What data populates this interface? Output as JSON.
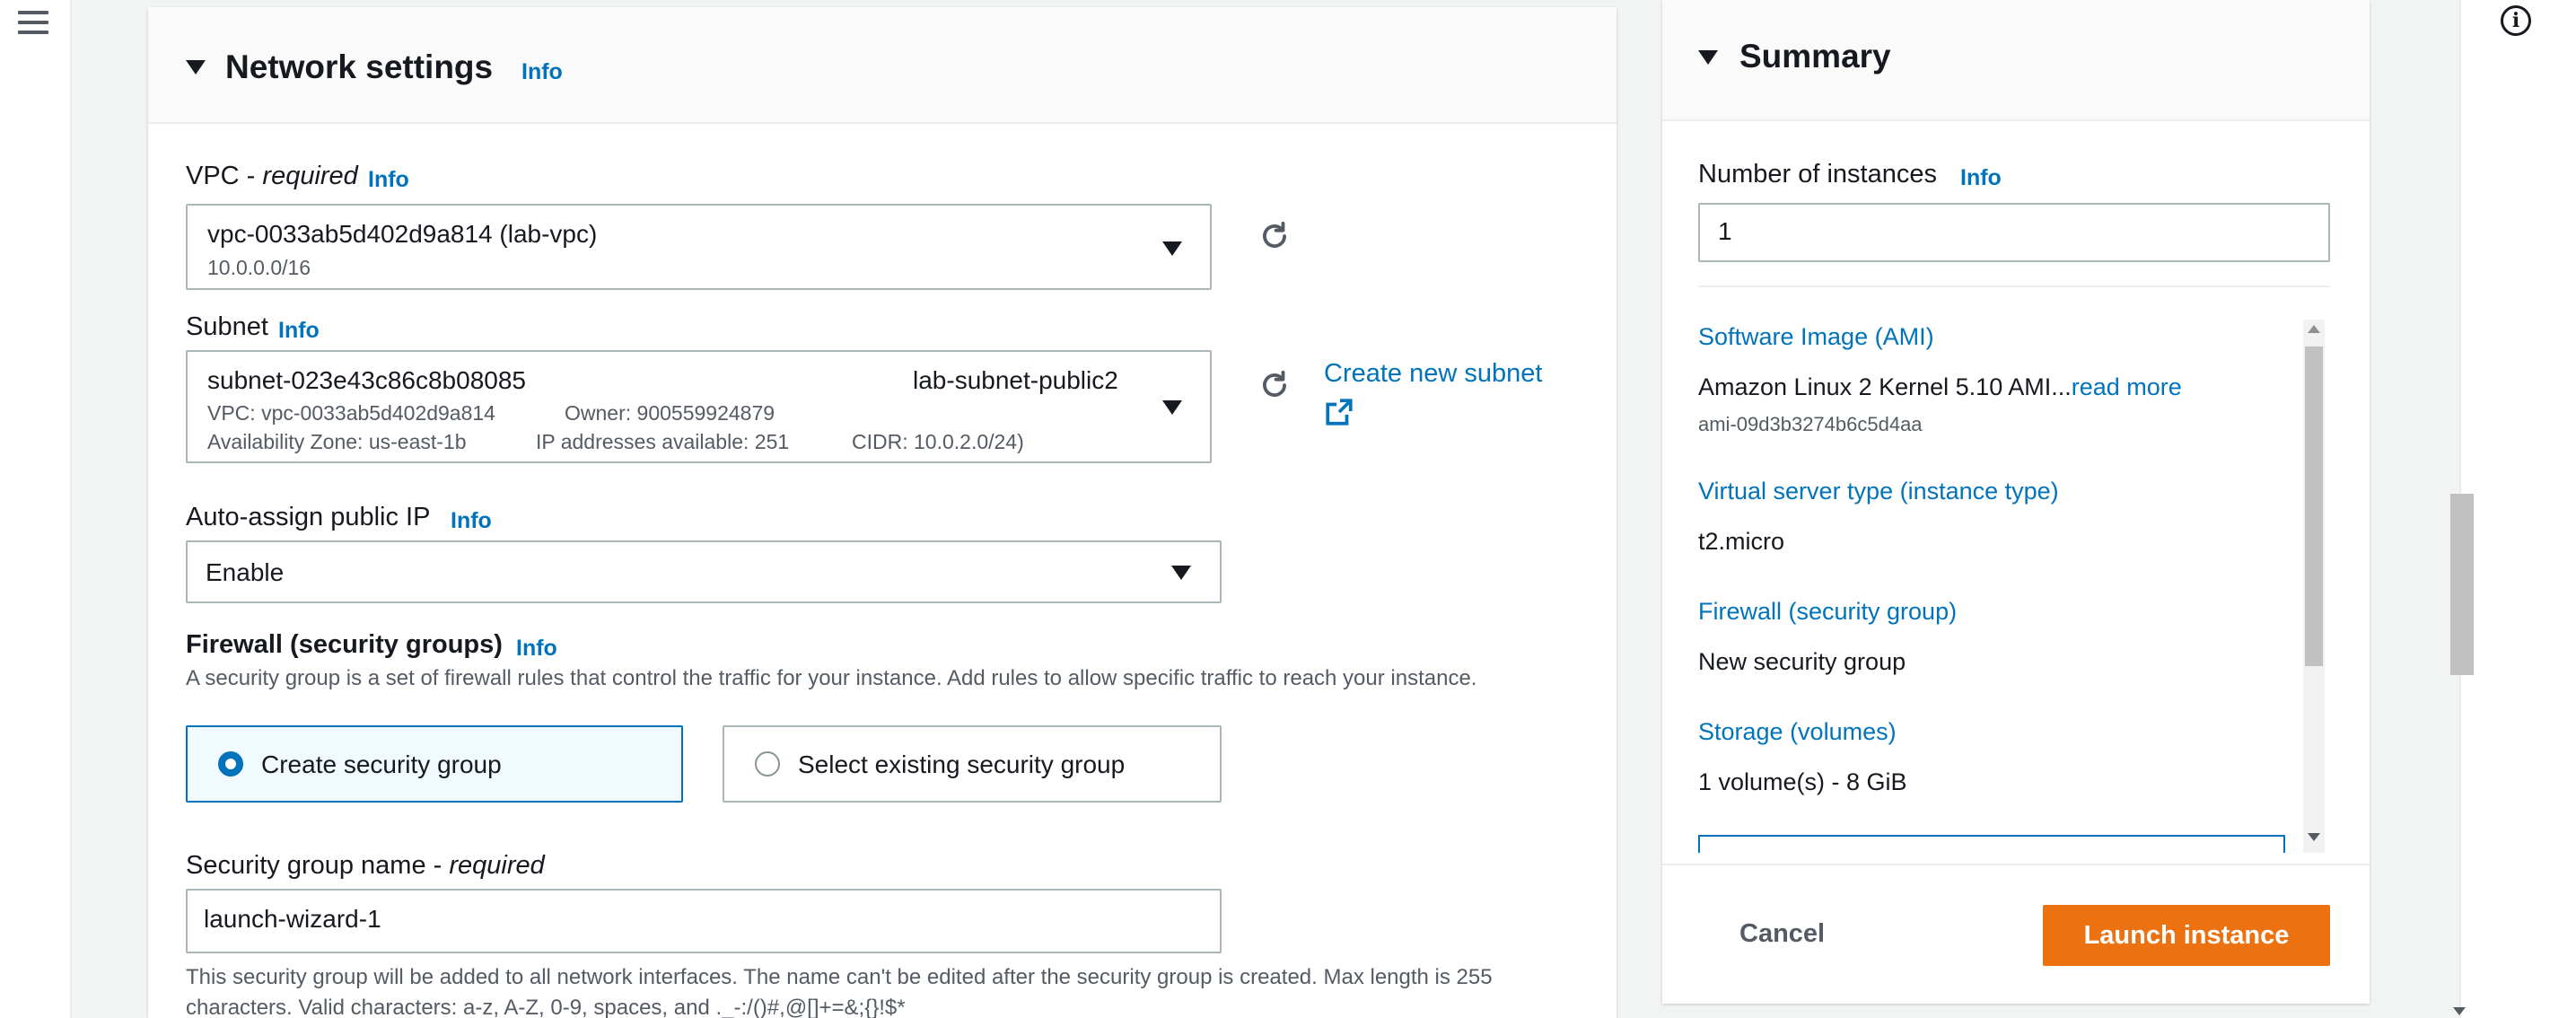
{
  "network": {
    "title": "Network settings",
    "info": "Info",
    "vpc": {
      "label_prefix": "VPC - ",
      "label_required": "required",
      "info": "Info",
      "value": "vpc-0033ab5d402d9a814 (lab-vpc)",
      "cidr": "10.0.0.0/16"
    },
    "subnet": {
      "label": "Subnet",
      "info": "Info",
      "value": "subnet-023e43c86c8b08085",
      "name": "lab-subnet-public2",
      "vpc": "VPC: vpc-0033ab5d402d9a814",
      "owner": "Owner: 900559924879",
      "az": "Availability Zone: us-east-1b",
      "ips": "IP addresses available: 251",
      "cidr": "CIDR: 10.0.2.0/24)",
      "create_link": "Create new subnet"
    },
    "auto_ip": {
      "label": "Auto-assign public IP",
      "info": "Info",
      "value": "Enable"
    },
    "firewall": {
      "label": "Firewall (security groups)",
      "info": "Info",
      "description": "A security group is a set of firewall rules that control the traffic for your instance. Add rules to allow specific traffic to reach your instance.",
      "option_create": "Create security group",
      "option_existing": "Select existing security group"
    },
    "sg_name": {
      "label_prefix": "Security group name - ",
      "label_required": "required",
      "value": "launch-wizard-1",
      "help": "This security group will be added to all network interfaces. The name can't be edited after the security group is created. Max length is 255 characters. Valid characters: a-z, A-Z, 0-9, spaces, and ._-:/()#,@[]+=&;{}!$*"
    }
  },
  "summary": {
    "title": "Summary",
    "instances_label": "Number of instances",
    "instances_info": "Info",
    "instances_value": "1",
    "ami_label": "Software Image (AMI)",
    "ami_value": "Amazon Linux 2 Kernel 5.10 AMI...",
    "ami_read_more": "read more",
    "ami_id": "ami-09d3b3274b6c5d4aa",
    "type_label": "Virtual server type (instance type)",
    "type_value": "t2.micro",
    "firewall_label": "Firewall (security group)",
    "firewall_value": "New security group",
    "storage_label": "Storage (volumes)",
    "storage_value": "1 volume(s) - 8 GiB",
    "cancel": "Cancel",
    "launch": "Launch instance"
  },
  "icons": {
    "menu": "hamburger-menu-icon",
    "info": "info-circle-icon",
    "refresh": "refresh-icon",
    "external": "external-link-icon"
  },
  "colors": {
    "link": "#0073bb",
    "primary_button": "#ec7211",
    "background": "#f2f3f3"
  }
}
